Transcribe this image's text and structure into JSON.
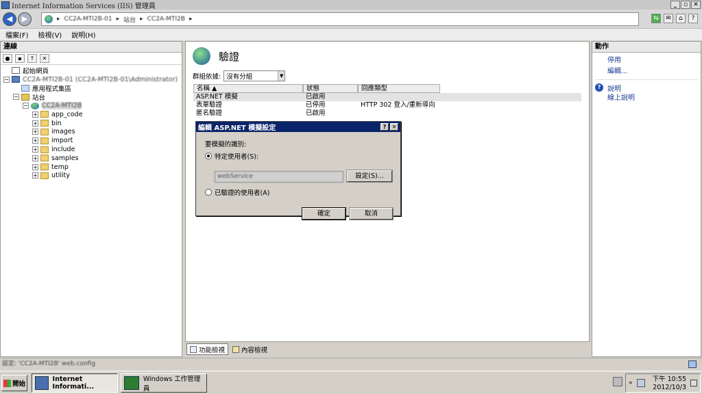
{
  "window": {
    "title": "Internet Information Services (IIS) 管理員",
    "controls": [
      "_",
      "▫",
      "✕"
    ]
  },
  "address": {
    "segments": [
      "CC2A-MTI2B-01",
      "站台",
      "CC2A-MTI2B"
    ],
    "separator": "▸",
    "tools": [
      "⇆",
      "✉",
      "⌂",
      "?"
    ]
  },
  "menu": [
    "檔案(F)",
    "檢視(V)",
    "說明(H)"
  ],
  "connections": {
    "header": "連線",
    "tree": [
      {
        "label": "起始網頁",
        "level": 0,
        "icon": "page",
        "expander": "",
        "blur": false
      },
      {
        "label": "CC2A-MTI2B-01 (CC2A-MTI2B-01\\Administrator)",
        "level": 0,
        "icon": "server",
        "expander": "−",
        "blur": true
      },
      {
        "label": "應用程式集區",
        "level": 1,
        "icon": "pool",
        "expander": "",
        "blur": false
      },
      {
        "label": "站台",
        "level": 1,
        "icon": "sites",
        "expander": "−",
        "blur": false
      },
      {
        "label": "CC2A-MTI2B",
        "level": 2,
        "icon": "globe",
        "expander": "−",
        "blur": true,
        "selected": true
      },
      {
        "label": "app_code",
        "level": 3,
        "icon": "folder",
        "expander": "+",
        "blur": false
      },
      {
        "label": "bin",
        "level": 3,
        "icon": "folder",
        "expander": "+",
        "blur": false
      },
      {
        "label": "images",
        "level": 3,
        "icon": "folder",
        "expander": "+",
        "blur": false
      },
      {
        "label": "import",
        "level": 3,
        "icon": "folder",
        "expander": "+",
        "blur": false
      },
      {
        "label": "include",
        "level": 3,
        "icon": "folder",
        "expander": "+",
        "blur": false
      },
      {
        "label": "samples",
        "level": 3,
        "icon": "folder",
        "expander": "+",
        "blur": false
      },
      {
        "label": "temp",
        "level": 3,
        "icon": "folder",
        "expander": "+",
        "blur": false
      },
      {
        "label": "utility",
        "level": 3,
        "icon": "folder",
        "expander": "+",
        "blur": false
      }
    ]
  },
  "feature": {
    "title": "驗證",
    "group_label": "群組依據:",
    "group_value": "沒有分組",
    "columns": [
      "名稱",
      "狀態",
      "回應類型"
    ],
    "rows": [
      {
        "name": "ASP.NET 模擬",
        "status": "已啟用",
        "response": "",
        "selected": true
      },
      {
        "name": "表單驗證",
        "status": "已停用",
        "response": "HTTP 302 登入/重新導向",
        "selected": false
      },
      {
        "name": "匿名驗證",
        "status": "已啟用",
        "response": "",
        "selected": false
      }
    ],
    "view_tabs": [
      "功能檢視",
      "內容檢視"
    ]
  },
  "actions": {
    "header": "動作",
    "items": [
      "停用",
      "編輯..."
    ],
    "help_items": [
      "說明",
      "線上說明"
    ]
  },
  "dialog": {
    "title": "編輯 ASP.NET 模擬設定",
    "identity_label": "要模擬的識別:",
    "specific_user_label": "特定使用者(S):",
    "specific_user_value": "webService",
    "set_button": "設定(S)...",
    "authenticated_user_label": "已驗證的使用者(A)",
    "ok_button": "確定",
    "cancel_button": "取消",
    "specific_user_selected": true
  },
  "status": {
    "text": "設定: 'CC2A-MTI2B' web.config"
  },
  "taskbar": {
    "start": "開始",
    "tasks": [
      "Internet Informati...",
      "Windows 工作管理員"
    ],
    "time": "下午 10:55",
    "date": "2012/10/3"
  }
}
